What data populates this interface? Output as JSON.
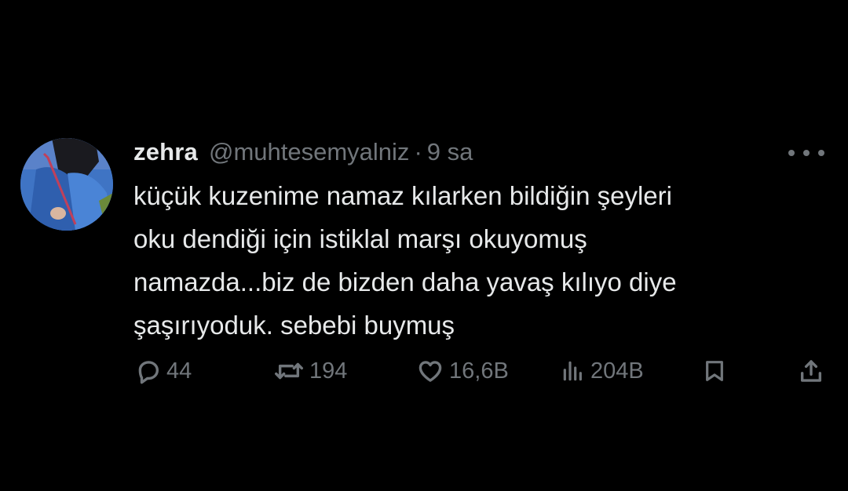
{
  "tweet": {
    "display_name": "zehra",
    "handle": "@muhtesemyalniz",
    "separator": "·",
    "time": "9 sa",
    "text_lines": [
      "küçük kuzenime namaz kılarken bildiğin şeyleri",
      "oku dendiği için istiklal marşı okuyomuş",
      "namazda...biz de bizden daha yavaş kılıyo diye",
      "şaşırıyoduk. sebebi buymuş"
    ]
  },
  "actions": {
    "replies": "44",
    "reposts": "194",
    "likes": "16,6B",
    "views": "204B"
  },
  "icons": {
    "avatar": "avatar",
    "more": "more-horizontal-icon",
    "reply": "reply-icon",
    "repost": "repost-icon",
    "like": "heart-icon",
    "views": "views-icon",
    "bookmark": "bookmark-icon",
    "share": "share-icon"
  },
  "colors": {
    "background": "#000000",
    "primary_text": "#e7e9ea",
    "secondary_text": "#71767b"
  }
}
